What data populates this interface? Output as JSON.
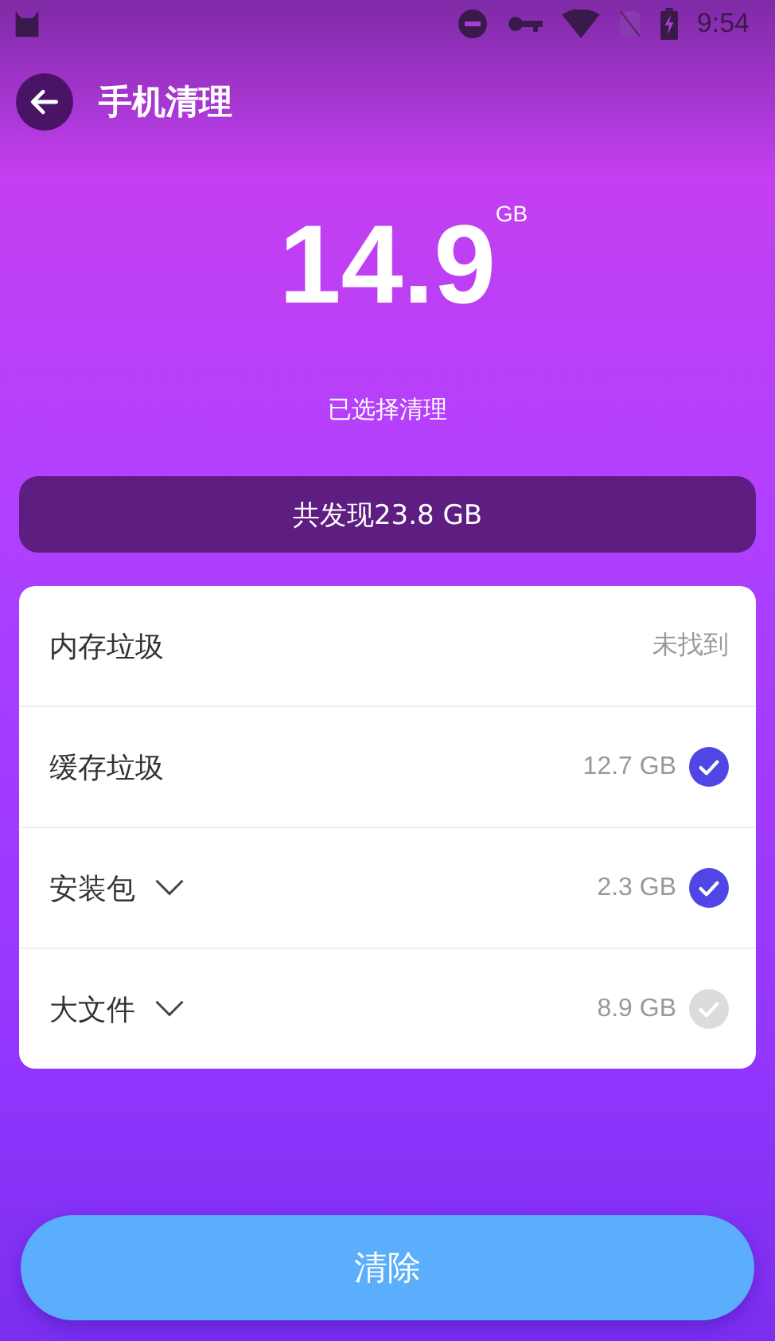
{
  "status_bar": {
    "time": "9:54"
  },
  "header": {
    "title": "手机清理"
  },
  "summary": {
    "value": "14.9",
    "unit": "GB",
    "caption": "已选择清理"
  },
  "found_bar": {
    "text": "共发现23.8 GB"
  },
  "items": [
    {
      "kind": "status",
      "label": "内存垃圾",
      "expandable": false,
      "value": "未找到"
    },
    {
      "kind": "size",
      "label": "缓存垃圾",
      "expandable": false,
      "value": "12.7 GB",
      "checked": true
    },
    {
      "kind": "size",
      "label": "安装包",
      "expandable": true,
      "value": "2.3 GB",
      "checked": true
    },
    {
      "kind": "size",
      "label": "大文件",
      "expandable": true,
      "value": "8.9 GB",
      "checked": false
    }
  ],
  "clean_button": {
    "label": "清除"
  }
}
